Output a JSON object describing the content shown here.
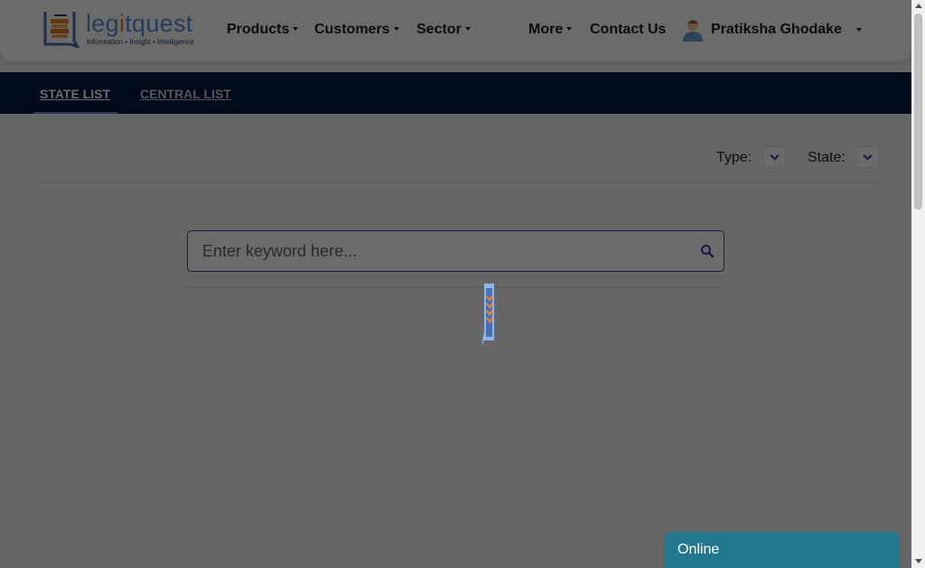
{
  "header": {
    "logo": {
      "word_prefix": "leg",
      "word_accent": "i",
      "word_suffix": "tquest",
      "tagline": "Information • Insight • Intelligence"
    },
    "nav": [
      {
        "label": "Products",
        "has_dropdown": true
      },
      {
        "label": "Customers",
        "has_dropdown": true
      },
      {
        "label": "Sector",
        "has_dropdown": true
      },
      {
        "label": "More",
        "has_dropdown": true
      },
      {
        "label": "Contact Us",
        "has_dropdown": false
      }
    ],
    "user": {
      "name": "Pratiksha Ghodake",
      "avatar_icon": "user-avatar-icon"
    }
  },
  "tabs": [
    {
      "label": "STATE LIST",
      "active": true
    },
    {
      "label": "CENTRAL LIST",
      "active": false
    }
  ],
  "filters": {
    "type_label": "Type:",
    "type_value": "",
    "state_label": "State:",
    "state_value": ""
  },
  "search": {
    "placeholder": "Enter keyword here...",
    "value": "",
    "icon": "search-icon"
  },
  "loader": {
    "icon": "loading-spinner-icon"
  },
  "chat": {
    "label": "Online"
  },
  "colors": {
    "brand_blue": "#5b8fd8",
    "brand_orange": "#e8812a",
    "tabbar_bg": "#00173d",
    "chat_bg": "#23778f",
    "accent_border": "#3a3fae"
  }
}
